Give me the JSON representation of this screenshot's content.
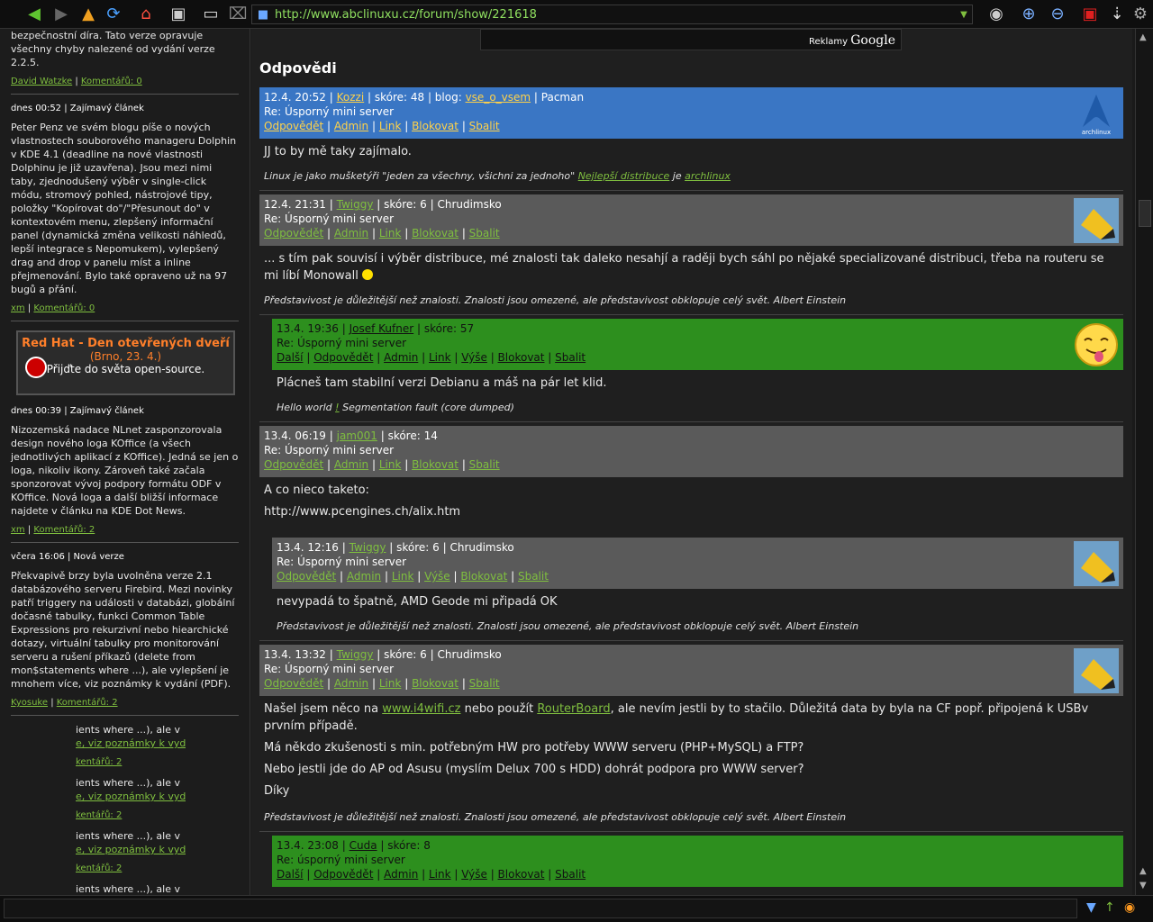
{
  "browser": {
    "url": "http://www.abclinuxu.cz/forum/show/221618",
    "icons": [
      "back-icon",
      "forward-icon",
      "up-icon",
      "reload-icon",
      "home-icon",
      "terminal-icon",
      "window-icon",
      "stop-icon",
      "binoculars-icon",
      "zoom-in-icon",
      "zoom-out-icon",
      "lock-icon",
      "download-icon",
      "gear-icon"
    ]
  },
  "sidebar": {
    "a0": {
      "text": "bezpečnostní díra. Tato verze opravuje všechny chyby nalezené od vydání verze 2.2.5.",
      "author": "David Watzke",
      "comments": "Komentářů: 0"
    },
    "a1": {
      "meta": "dnes 00:52 | Zajímavý článek",
      "text": "Peter Penz ve svém blogu píše o nových vlastnostech souborového manageru Dolphin v KDE 4.1 (deadline na nové vlastnosti Dolphinu je již uzavřena). Jsou mezi nimi taby, zjednodušený výběr v single-click módu, stromový pohled, nástrojové tipy, položky \"Kopírovat do\"/\"Přesunout do\" v kontextovém menu, zlepšený informační panel (dynamická změna velikosti náhledů, lepší integrace s Nepomukem), vylepšený drag and drop v panelu míst a inline přejmenování. Bylo také opraveno už na 97 bugů a přání.",
      "author": "xm",
      "comments": "Komentářů: 0"
    },
    "ad": {
      "title": "Red Hat - Den otevřených dveří",
      "sub": "(Brno, 23. 4.)",
      "text": "Přijďte do světa open-source."
    },
    "a2": {
      "meta": "dnes 00:39 | Zajímavý článek",
      "text": "Nizozemská nadace NLnet zasponzorovala design nového loga KOffice (a všech jednotlivých aplikací z KOffice). Jedná se jen o loga, nikoliv ikony. Zároveň také začala sponzorovat vývoj podpory formátu ODF v KOffice. Nová loga a další bližší informace najdete v článku na KDE Dot News.",
      "author": "xm",
      "comments": "Komentářů: 2"
    },
    "a3": {
      "meta": "včera 16:06 | Nová verze",
      "text": "Překvapivě brzy byla uvolněna verze 2.1 databázového serveru Firebird. Mezi novinky patří triggery na události v databázi, globální dočasné tabulky, funkci Common Table Expressions pro rekurzivní nebo hiearchické dotazy, virtuální tabulky pro monitorování serveru a rušení příkazů (delete from mon$statements where ...), ale vylepšení je mnohem více, viz poznámky k vydání (PDF).",
      "author": "Kyosuke",
      "comments": "Komentářů: 2"
    },
    "ghost": {
      "l1": "ients where ...), ale v",
      "l2": "e, viz poznámky k vyd",
      "f": "kentářů: 2"
    }
  },
  "main": {
    "ad_label": "Reklamy",
    "ad_brand": "Google",
    "heading": "Odpovědi",
    "comments": [
      {
        "date": "12.4. 20:52",
        "author": "Kozzi",
        "score": "skóre: 48",
        "blog_label": "blog:",
        "blog": "vse_o_vsem",
        "extra": "Pacman",
        "title": "Re: Úsporný mini server",
        "links": [
          "Odpovědět",
          "Admin",
          "Link",
          "Blokovat",
          "Sbalit"
        ],
        "avatar": "archlinux",
        "body": [
          "JJ to by mě taky zajímalo."
        ],
        "sig_pre": "Linux je jako mušketýři \"jeden za všechny, všichni za jednoho\"",
        "sig_l1": "Nejlepší distribuce",
        "sig_mid": "je",
        "sig_l2": "archlinux"
      },
      {
        "date": "12.4. 21:31",
        "author": "Twiggy",
        "score": "skóre: 6",
        "extra": "Chrudimsko",
        "title": "Re: Úsporný mini server",
        "links": [
          "Odpovědět",
          "Admin",
          "Link",
          "Blokovat",
          "Sbalit"
        ],
        "body": [
          "... s tím pak souvisí i výběr distribuce, mé znalosti tak daleko nesahjí a raději bych sáhl po nějaké specializované distribuci, třeba na routeru se mi líbí Monowall"
        ],
        "sig": "Představivost je důležitější než znalosti. Znalosti jsou omezené, ale představivost obklopuje celý svět. Albert Einstein"
      },
      {
        "date": "13.4. 19:36",
        "author": "Josef Kufner",
        "score": "skóre: 57",
        "title": "Re: Úsporný mini server",
        "links": [
          "Další",
          "Odpovědět",
          "Admin",
          "Link",
          "Výše",
          "Blokovat",
          "Sbalit"
        ],
        "body": [
          "Plácneš tam stabilní verzi Debianu a máš na pár let klid."
        ],
        "sig_pre": "Hello world",
        "sig_l1": "!",
        "sig_post": "Segmentation fault (core dumped)"
      },
      {
        "date": "13.4. 06:19",
        "author": "jam001",
        "score": "skóre: 14",
        "title": "Re: Úsporný mini server",
        "links": [
          "Odpovědět",
          "Admin",
          "Link",
          "Blokovat",
          "Sbalit"
        ],
        "body": [
          "A co nieco taketo:",
          "http://www.pcengines.ch/alix.htm"
        ]
      },
      {
        "date": "13.4. 12:16",
        "author": "Twiggy",
        "score": "skóre: 6",
        "extra": "Chrudimsko",
        "title": "Re: Úsporný mini server",
        "links": [
          "Odpovědět",
          "Admin",
          "Link",
          "Výše",
          "Blokovat",
          "Sbalit"
        ],
        "body": [
          "nevypadá to špatně, AMD Geode mi připadá OK"
        ],
        "sig": "Představivost je důležitější než znalosti. Znalosti jsou omezené, ale představivost obklopuje celý svět. Albert Einstein"
      },
      {
        "date": "13.4. 13:32",
        "author": "Twiggy",
        "score": "skóre: 6",
        "extra": "Chrudimsko",
        "title": "Re: Úsporný mini server",
        "links": [
          "Odpovědět",
          "Admin",
          "Link",
          "Blokovat",
          "Sbalit"
        ],
        "body_pre": "Našel jsem něco na",
        "body_l1": "www.i4wifi.cz",
        "body_mid": "nebo použít",
        "body_l2": "RouterBoard",
        "body_post": ", ale nevím jestli by to stačilo. Důležitá data by byla na CF popř. připojená k USBv prvním případě.",
        "body": [
          "Má někdo zkušenosti s min. potřebným HW pro potřeby WWW serveru (PHP+MySQL) a FTP?",
          "Nebo jestli jde do AP od Asusu (myslím Delux 700 s HDD) dohrát podpora pro WWW server?",
          "Díky"
        ],
        "sig": "Představivost je důležitější než znalosti. Znalosti jsou omezené, ale představivost obklopuje celý svět. Albert Einstein"
      },
      {
        "date": "13.4. 23:08",
        "author": "Cuda",
        "score": "skóre: 8",
        "title": "Re: úsporný mini server",
        "links": [
          "Další",
          "Odpovědět",
          "Admin",
          "Link",
          "Výše",
          "Blokovat",
          "Sbalit"
        ]
      }
    ]
  },
  "colors": {
    "blue_header": "#3a76c4",
    "gray_header": "#5a5a5a",
    "green_header": "#2d8f1e",
    "link_green": "#7fbf3f",
    "link_yellow": "#ffd24a"
  }
}
